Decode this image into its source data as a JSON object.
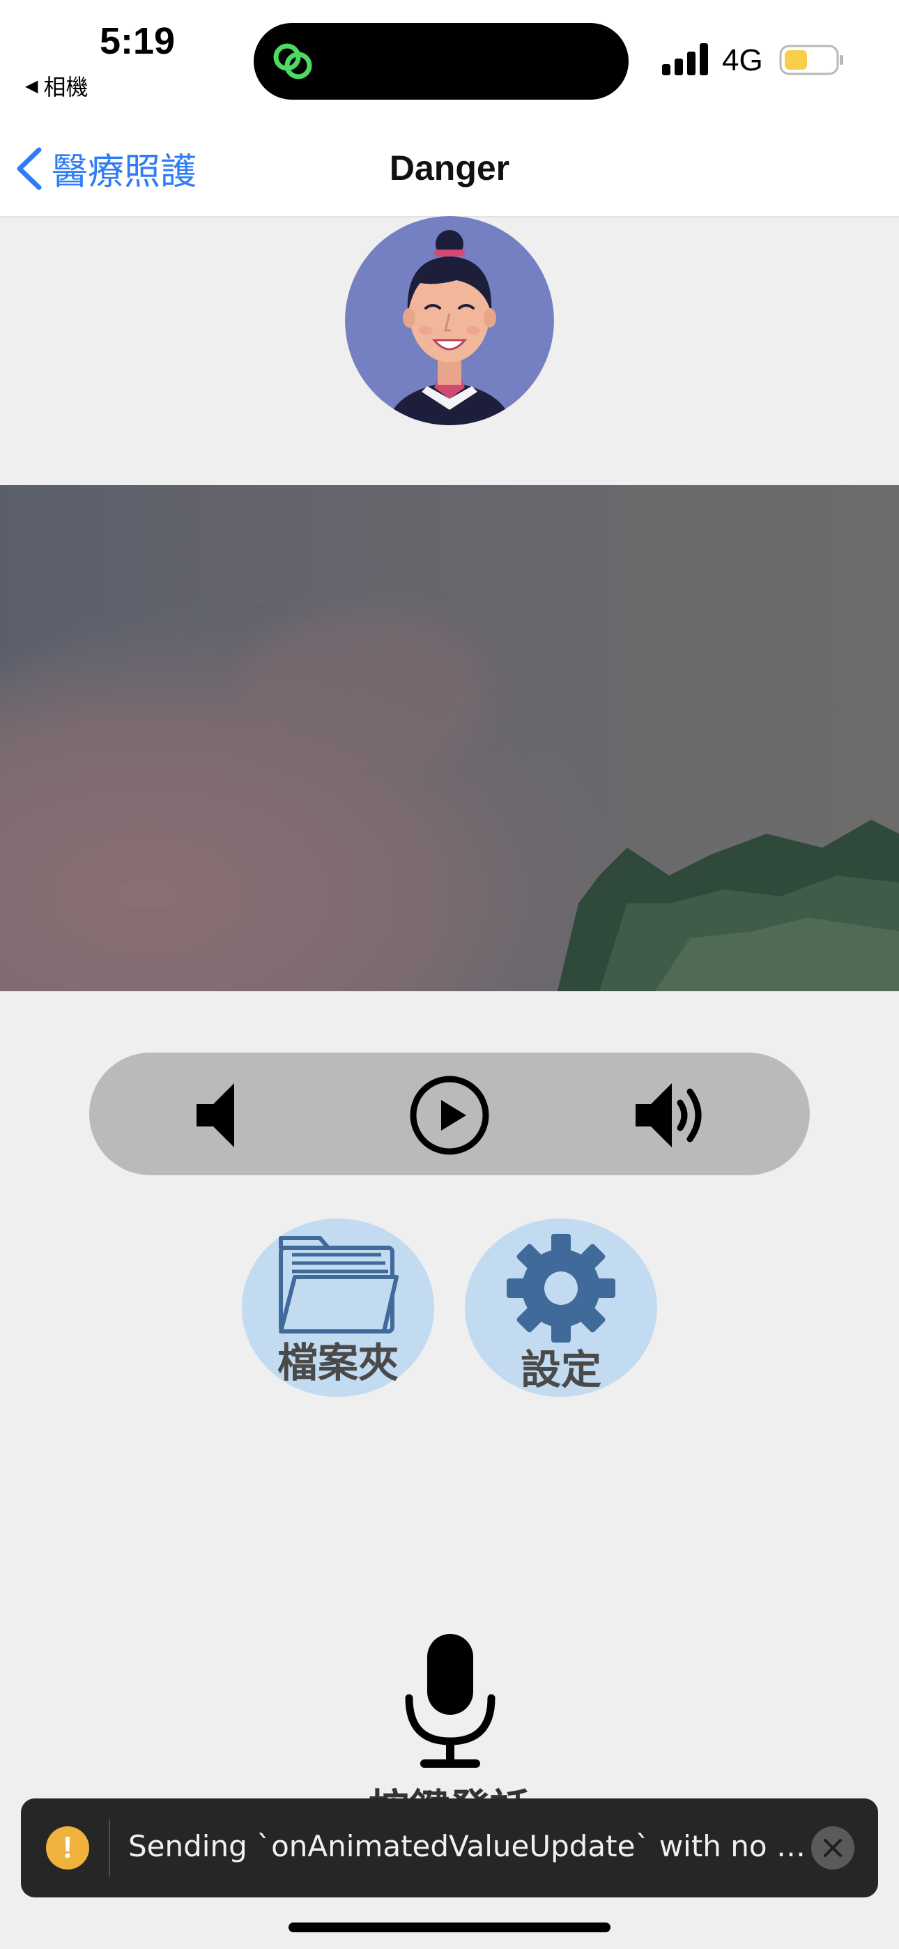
{
  "status_bar": {
    "time": "5:19",
    "back_app": "相機",
    "network": "4G"
  },
  "nav": {
    "back_label": "醫療照護",
    "title": "Danger"
  },
  "controls": {
    "icons": [
      "volume-down-icon",
      "play-icon",
      "volume-up-icon"
    ]
  },
  "actions": {
    "folder_label": "檔案夾",
    "settings_label": "設定"
  },
  "mic": {
    "label": "按鍵發話"
  },
  "toast": {
    "message": "Sending `onAnimatedValueUpdate` with no list..."
  },
  "colors": {
    "accent_blue": "#2f7cf6",
    "battery_yellow": "#f7cf4a",
    "action_bg": "#c3dbf1",
    "action_icon": "#3f6a99"
  }
}
